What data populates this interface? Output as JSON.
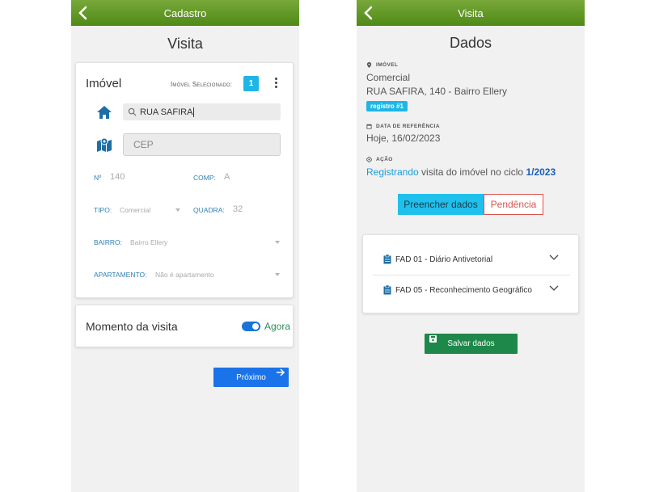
{
  "left": {
    "header_title": "Cadastro",
    "screen_title": "Visita",
    "imovel_card": {
      "title": "Imóvel",
      "selected_label": "Imóvel Selecionado:",
      "selected_count": "1",
      "search_value": "RUA SAFIRA",
      "cep_placeholder": "CEP",
      "numero_label": "Nº",
      "numero_value": "140",
      "comp_label": "COMP:",
      "comp_value": "A",
      "tipo_label": "TIPO:",
      "tipo_value": "Comercial",
      "quadra_label": "QUADRA:",
      "quadra_value": "32",
      "bairro_label": "BAIRRO:",
      "bairro_value": "Bairro Ellery",
      "apartamento_label": "APARTAMENTO:",
      "apartamento_value": "Não é apartamento"
    },
    "momento_card": {
      "label": "Momento da visita",
      "toggle_on": true,
      "toggle_label": "Agora"
    },
    "next_button": "Próximo"
  },
  "right": {
    "header_title": "Visita",
    "screen_title": "Dados",
    "imovel_label": "IMÓVEL",
    "imovel_tipo": "Comercial",
    "imovel_endereco": "RUA SAFIRA, 140 - Bairro Ellery",
    "registro_badge": "registro #1",
    "data_label": "DATA DE REFERÊNCIA",
    "data_value": "Hoje, 16/02/2023",
    "acao_label": "AÇÃO",
    "acao_verb": "Registrando",
    "acao_middle": " visita do imóvel no ciclo ",
    "acao_ciclo": "1/2023",
    "tab_preencher": "Preencher dados",
    "tab_pendencia": "Pendência",
    "fad_items": [
      "FAD 01 - Diário Antivetorial",
      "FAD 05 - Reconhecimento Geográfico"
    ],
    "save_button": "Salvar dados"
  },
  "colors": {
    "header_green": "#5a9422",
    "accent_blue": "#1a73e8",
    "badge_cyan": "#1fb6e6",
    "save_green": "#1e874a",
    "pendencia_red": "#d9534f"
  }
}
